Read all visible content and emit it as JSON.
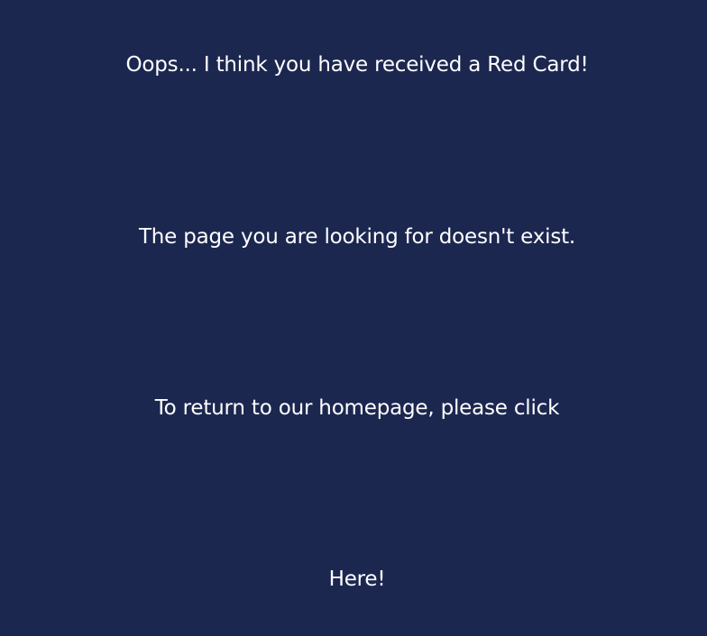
{
  "error_page": {
    "headline": "Oops... I think you have received a Red Card!",
    "message": "The page you are looking for doesn't exist.",
    "return_prompt": "To return to our homepage, please click",
    "home_link": "Here!"
  },
  "colors": {
    "background": "#1c2750",
    "text": "#ffffff"
  }
}
